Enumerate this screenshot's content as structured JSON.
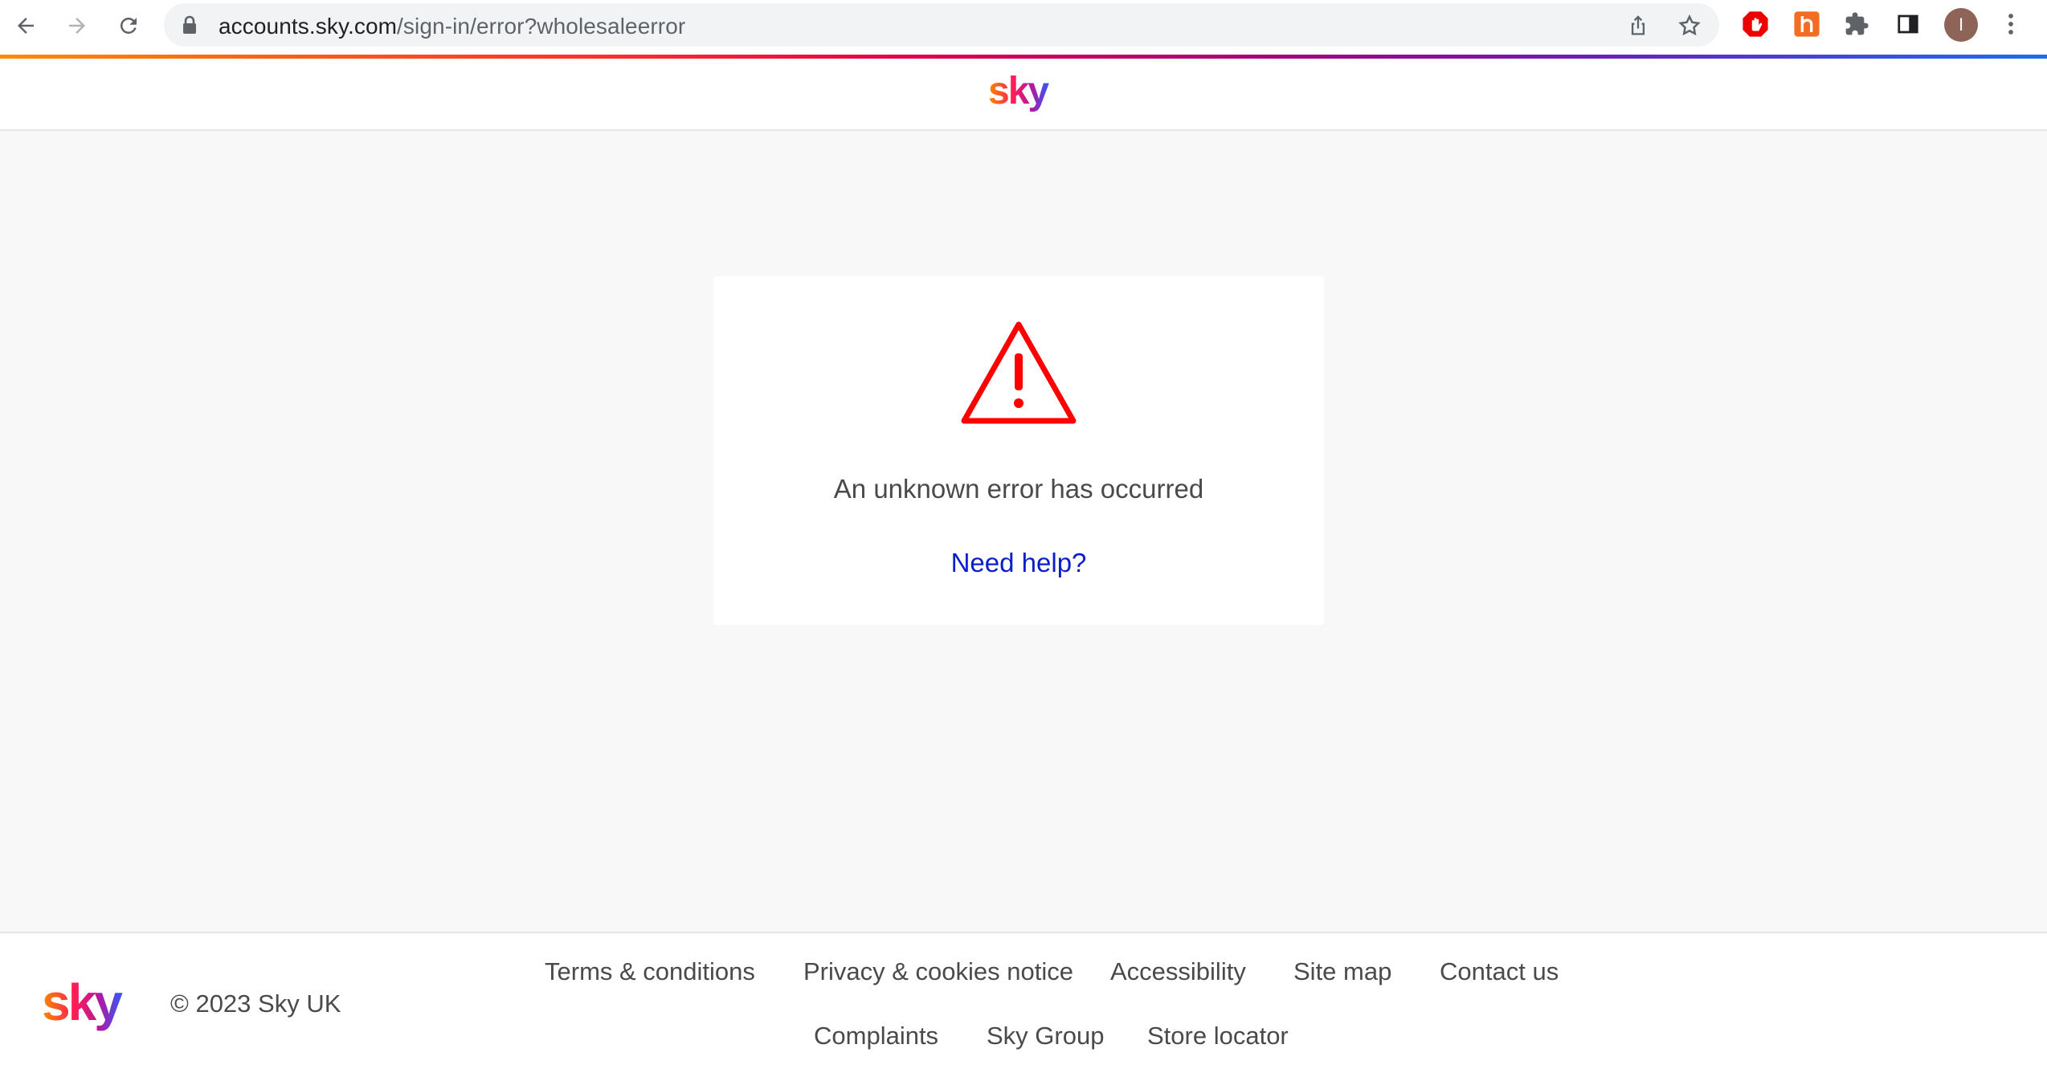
{
  "browser": {
    "url_host": "accounts.sky.com",
    "url_path": "/sign-in/error?wholesaleerror",
    "avatar_initial": "I",
    "icons": [
      "back-arrow-icon",
      "forward-arrow-icon",
      "reload-icon",
      "lock-icon",
      "share-icon",
      "star-icon",
      "adblock-extension-icon",
      "honey-extension-icon",
      "puzzle-extensions-icon",
      "side-panel-icon",
      "kebab-menu-icon"
    ]
  },
  "header": {
    "logo_text": "sky"
  },
  "error_card": {
    "icon": "warning-triangle-icon",
    "icon_color": "#ff0000",
    "message": "An unknown error has occurred",
    "help_link": "Need help?",
    "link_color": "#0a1ecc"
  },
  "footer": {
    "logo_text": "sky",
    "copyright": "© 2023 Sky UK",
    "links_row1": [
      "Terms & conditions",
      "Privacy & cookies notice",
      "Accessibility",
      "Site map",
      "Contact us"
    ],
    "links_row2": [
      "Complaints",
      "Sky Group",
      "Store locator"
    ]
  },
  "brand_colors": {
    "gradient_start": "#ff8a00",
    "gradient_mid": "#e0004b",
    "gradient_end": "#1b6ef0"
  }
}
